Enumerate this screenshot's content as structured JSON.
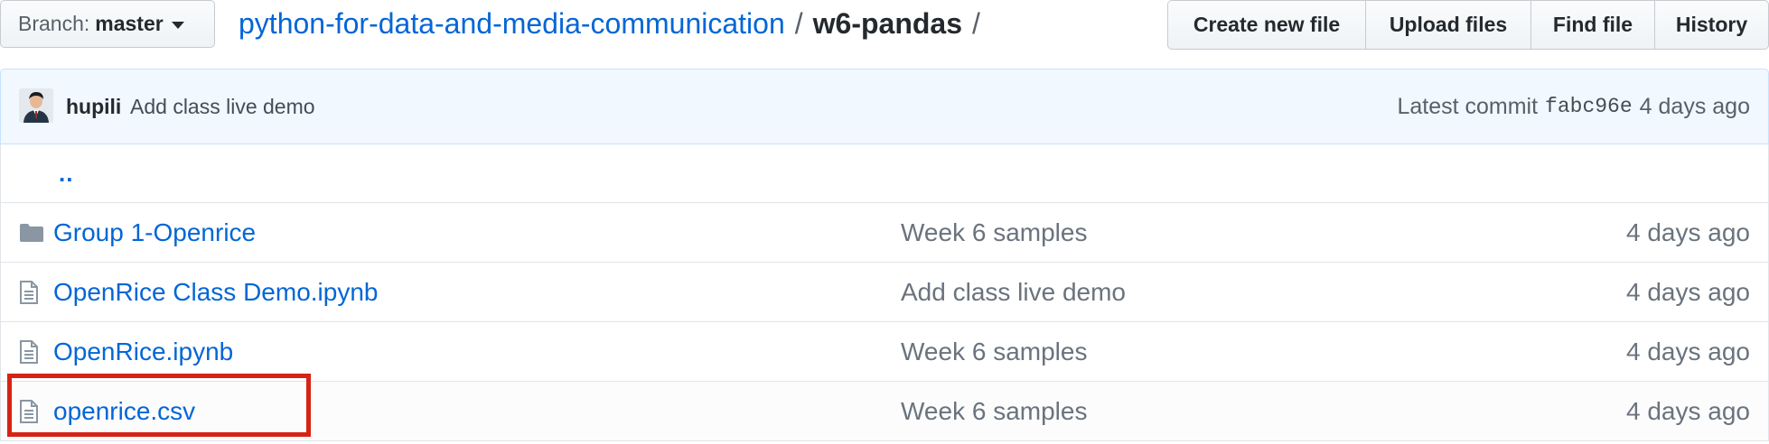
{
  "topbar": {
    "branch_prefix": "Branch:",
    "branch_name": "master",
    "repo_name": "python-for-data-and-media-communication",
    "path_separator": "/",
    "current_dir": "w6-pandas",
    "trailing_separator": "/",
    "buttons": {
      "create_new_file": "Create new file",
      "upload_files": "Upload files",
      "find_file": "Find file",
      "history": "History"
    }
  },
  "commit": {
    "author": "hupili",
    "message": "Add class live demo",
    "latest_label": "Latest commit",
    "sha": "fabc96e",
    "age": "4 days ago"
  },
  "files": {
    "parent_link": "..",
    "rows": [
      {
        "icon": "folder-icon",
        "name": "Group 1-Openrice",
        "message": "Week 6 samples",
        "age": "4 days ago"
      },
      {
        "icon": "file-icon",
        "name": "OpenRice Class Demo.ipynb",
        "message": "Add class live demo",
        "age": "4 days ago"
      },
      {
        "icon": "file-icon",
        "name": "OpenRice.ipynb",
        "message": "Week 6 samples",
        "age": "4 days ago"
      },
      {
        "icon": "file-icon",
        "name": "openrice.csv",
        "message": "Week 6 samples",
        "age": "4 days ago"
      }
    ]
  },
  "colors": {
    "link": "#0366d6",
    "highlight": "#d62315",
    "commit_bar_bg": "#f1f8ff",
    "icon": "#8a96a3"
  }
}
